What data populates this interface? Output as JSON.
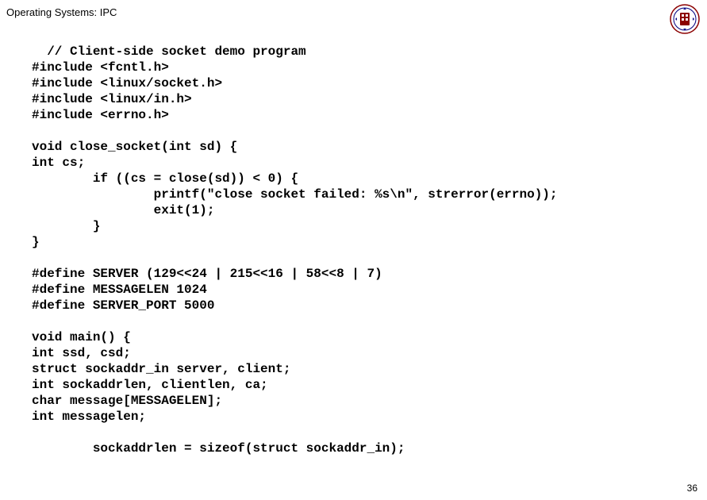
{
  "header": {
    "title": "Operating Systems: IPC"
  },
  "code": {
    "line1": "  // Client-side socket demo program",
    "line2": "#include <fcntl.h>",
    "line3": "#include <linux/socket.h>",
    "line4": "#include <linux/in.h>",
    "line5": "#include <errno.h>",
    "line6": "",
    "line7": "void close_socket(int sd) {",
    "line8": "int cs;",
    "line9": "        if ((cs = close(sd)) < 0) {",
    "line10": "                printf(\"close socket failed: %s\\n\", strerror(errno));",
    "line11": "                exit(1);",
    "line12": "        }",
    "line13": "}",
    "line14": "",
    "line15": "#define SERVER (129<<24 | 215<<16 | 58<<8 | 7)",
    "line16": "#define MESSAGELEN 1024",
    "line17": "#define SERVER_PORT 5000",
    "line18": "",
    "line19": "void main() {",
    "line20": "int ssd, csd;",
    "line21": "struct sockaddr_in server, client;",
    "line22": "int sockaddrlen, clientlen, ca;",
    "line23": "char message[MESSAGELEN];",
    "line24": "int messagelen;",
    "line25": "",
    "line26": "        sockaddrlen = sizeof(struct sockaddr_in);"
  },
  "footer": {
    "page_number": "36"
  }
}
